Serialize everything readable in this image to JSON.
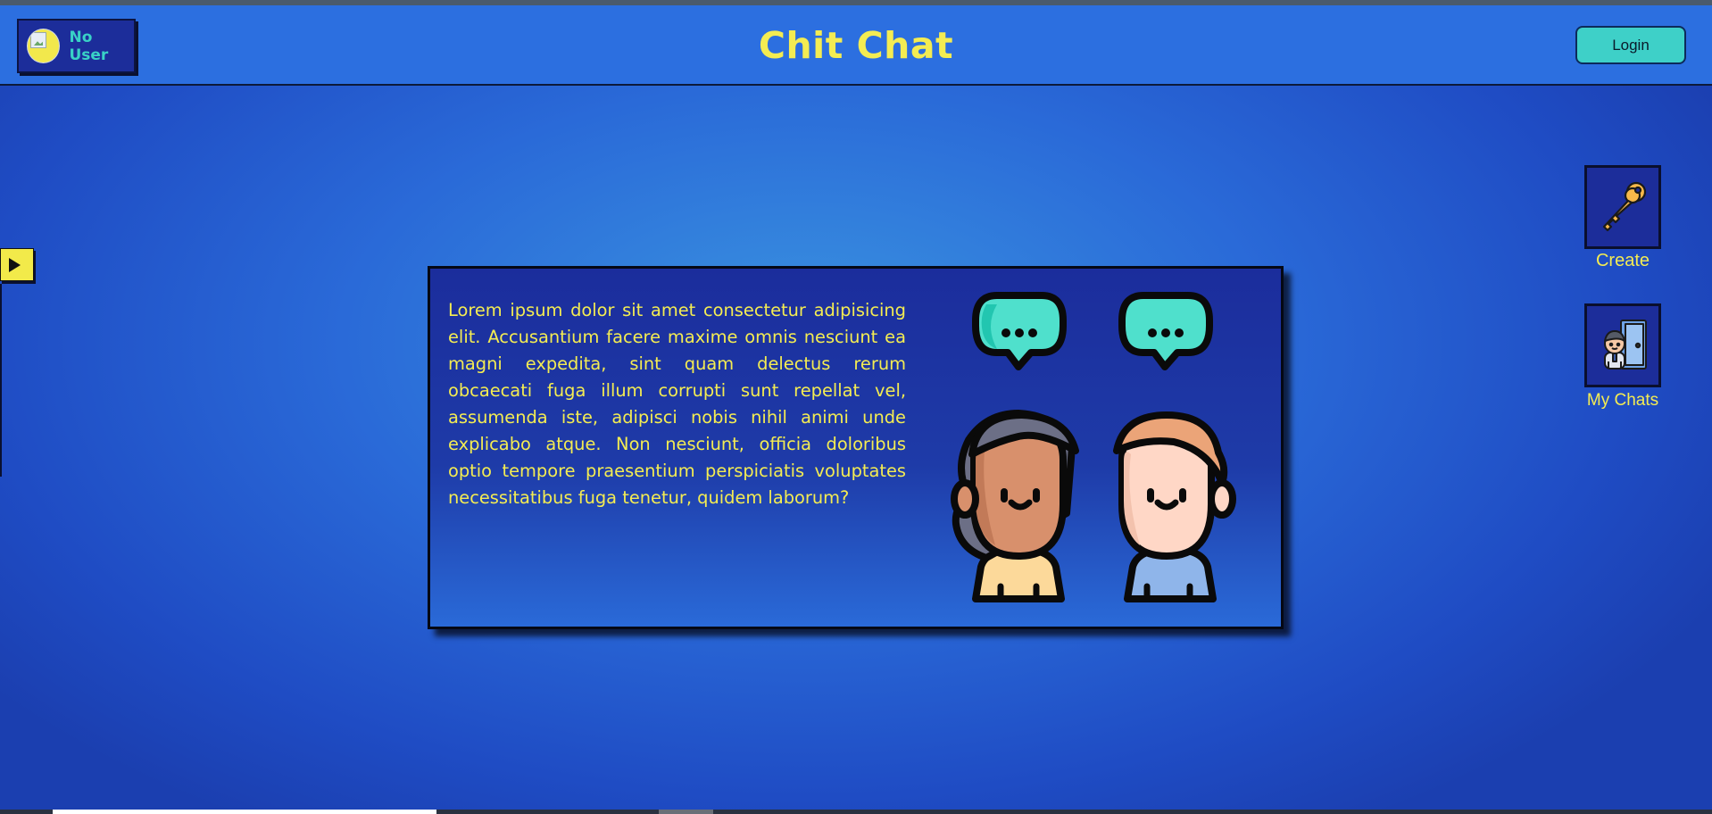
{
  "header": {
    "user_name": "No User",
    "app_title": "Chit Chat",
    "login_label": "Login"
  },
  "side_menu": {
    "items": [
      {
        "label": "Create",
        "icon": "key-icon"
      },
      {
        "label": "My Chats",
        "icon": "person-door-icon"
      }
    ]
  },
  "card": {
    "text": "Lorem ipsum dolor sit amet consectetur adipisicing elit. Accusantium facere maxime omnis nesciunt ea magni expedita, sint quam delectus rerum obcaecati fuga illum corrupti sunt repellat vel, assumenda iste, adipisci nobis nihil animi unde explicabo atque. Non nesciunt, officia doloribus optio tempore praesentium perspiciatis voluptates necessitatibus fuga tenetur, quidem laborum?",
    "illustration": "two-people-chatting-illustration"
  },
  "colors": {
    "accent_yellow": "#f4ec52",
    "accent_teal": "#3ed0c8",
    "header_blue": "#2c6fe0",
    "panel_navy": "#1c2d9a"
  }
}
